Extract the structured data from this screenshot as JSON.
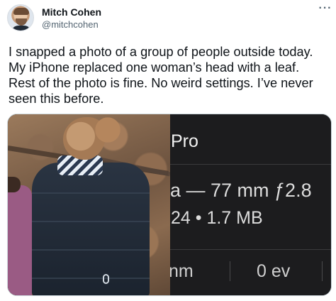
{
  "author": {
    "name": "Mitch Cohen",
    "handle": "@mitchcohen",
    "avatar_icon": "user-avatar"
  },
  "menu_icon": "more-options-icon",
  "menu_label": "···",
  "tweet": {
    "text": "I snapped a photo of a group of people outside today.\nMy iPhone replaced one woman’s head with a leaf.\nRest of the photo is fine. No weird settings. I’ve never\nseen this before."
  },
  "media": {
    "photo_description_icon": "photo",
    "info_panel": {
      "title": "Pro",
      "lens": "a — 77 mm ƒ2.8",
      "file": "24 • 1.7 MB",
      "focal_fragment": "nm",
      "exposure": "0 ev"
    },
    "colors": {
      "panel_bg": "#1c1c1e",
      "panel_text": "#e6e6e6"
    }
  }
}
